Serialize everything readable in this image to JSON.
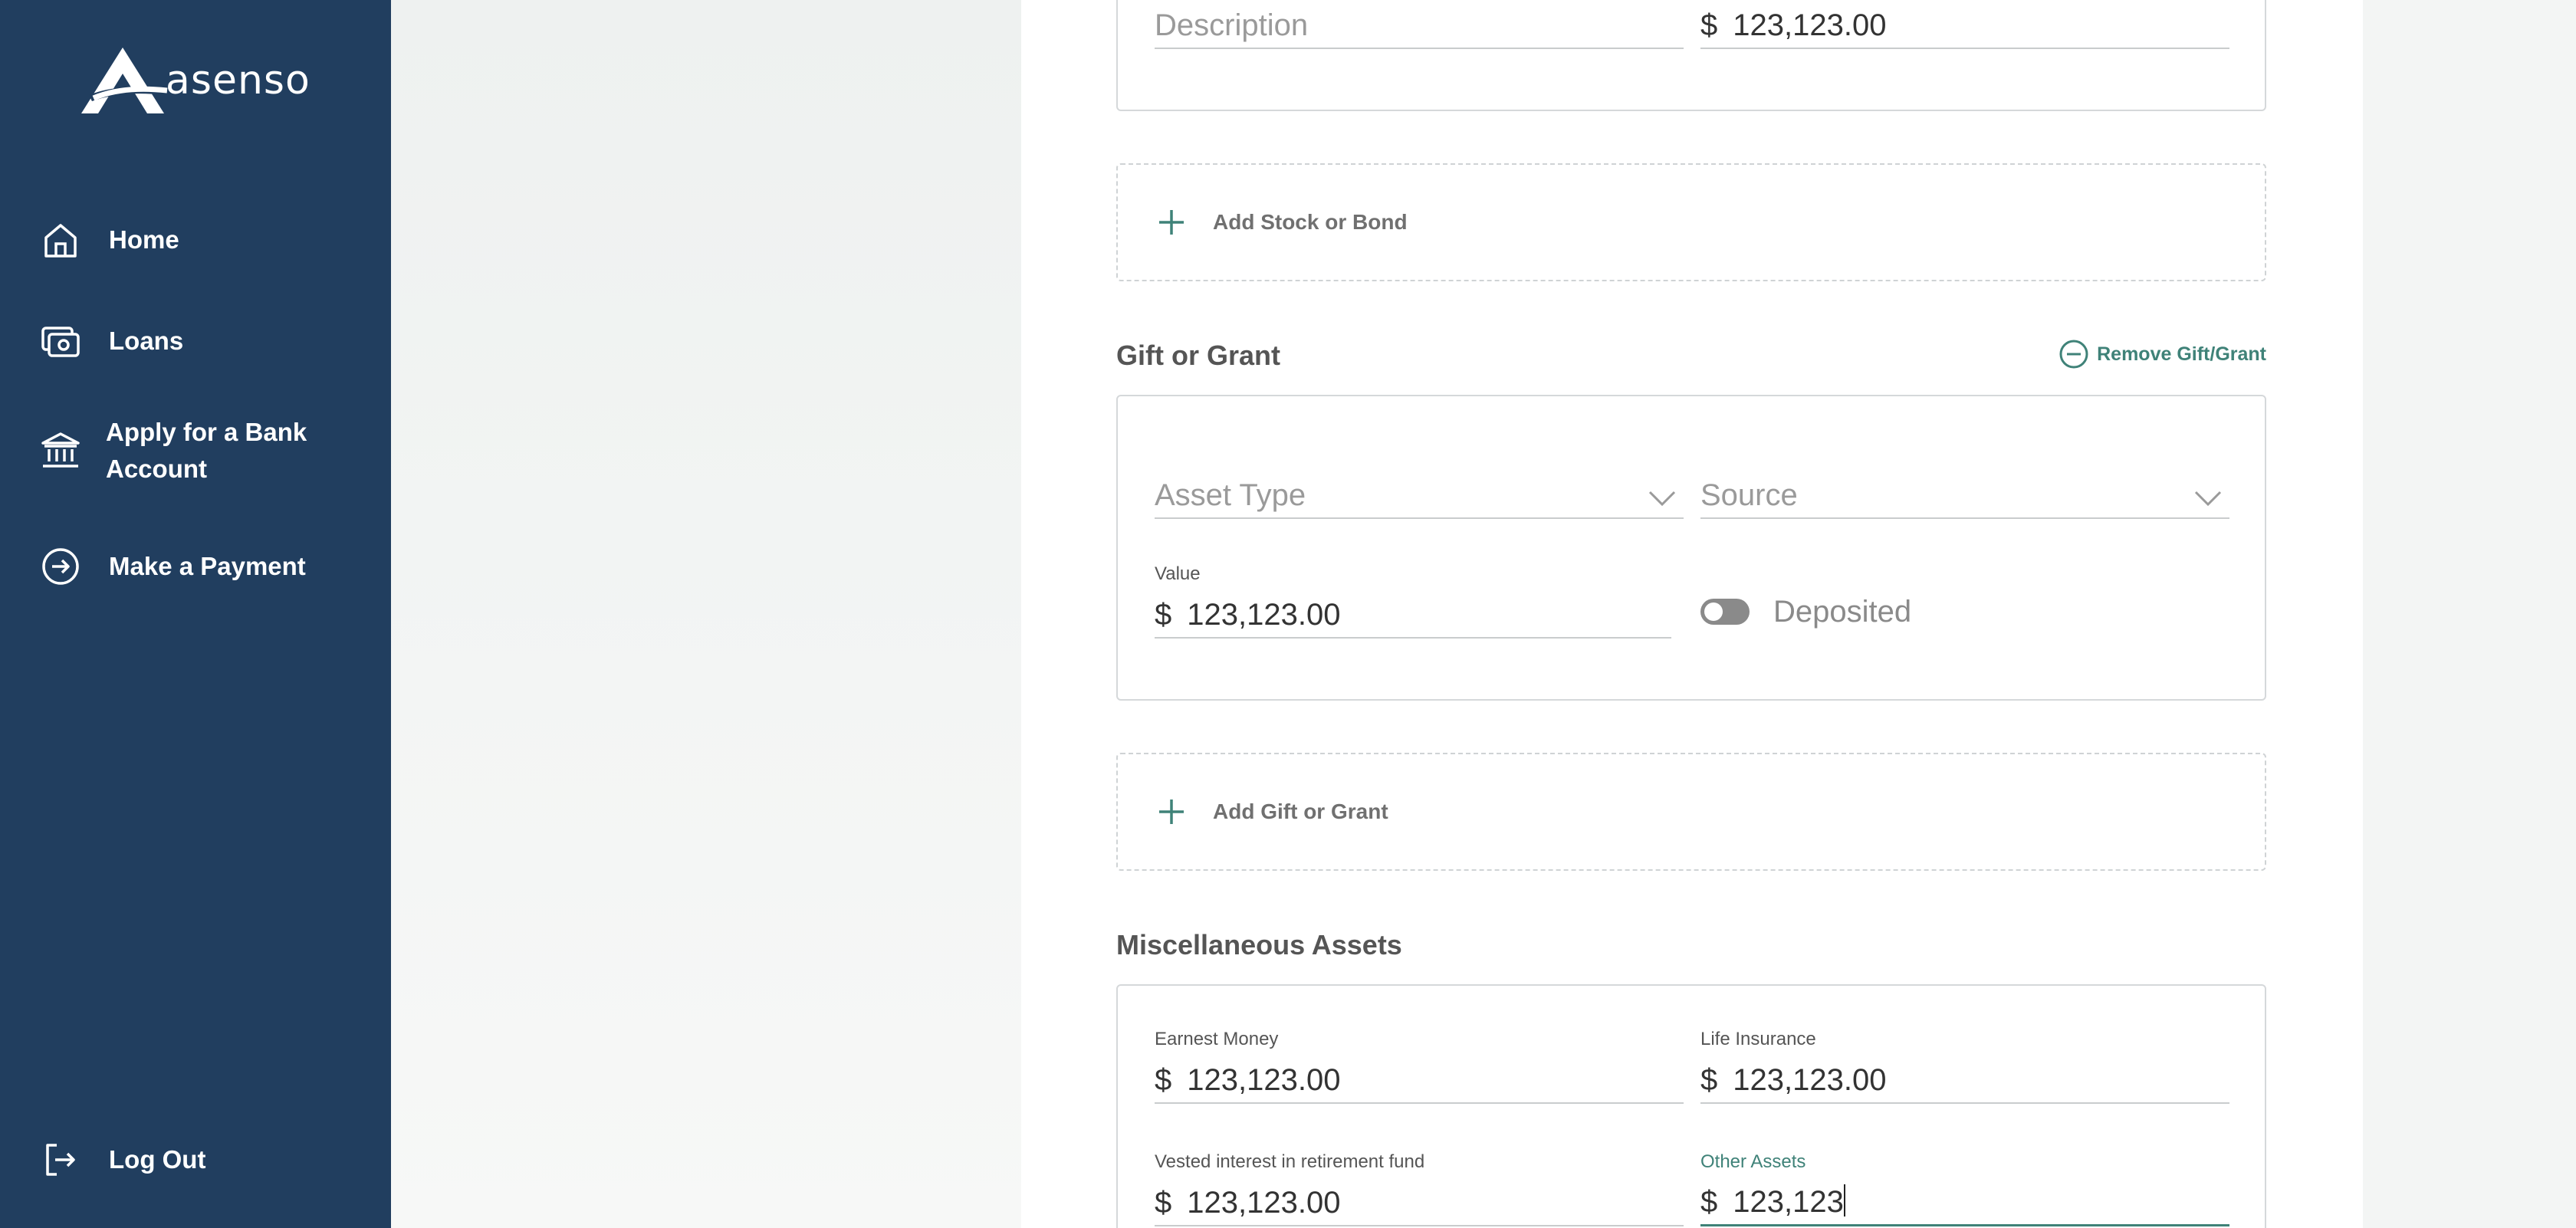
{
  "brand": {
    "logo_text": "asenso",
    "color": "#213e5f",
    "accent": "#3f8278"
  },
  "sidebar": {
    "items": [
      {
        "label": "Home",
        "icon": "home-icon"
      },
      {
        "label": "Loans",
        "icon": "money-icon"
      },
      {
        "label": "Apply for a Bank Account",
        "line1": "Apply for a Bank",
        "line2": "Account",
        "icon": "bank-icon"
      },
      {
        "label": "Make a Payment",
        "icon": "arrow-circle-icon"
      }
    ],
    "logout": {
      "label": "Log Out",
      "icon": "logout-icon"
    }
  },
  "stocks_card": {
    "description_placeholder": "Description",
    "currency": "$",
    "value": "123,123.00"
  },
  "add_stock": {
    "label": "Add Stock or Bond",
    "icon": "plus-icon"
  },
  "gift": {
    "title": "Gift or Grant",
    "remove_label": "Remove Gift/Grant",
    "asset_type_placeholder": "Asset Type",
    "source_placeholder": "Source",
    "value_label": "Value",
    "currency": "$",
    "value": "123,123.00",
    "deposited_label": "Deposited",
    "deposited_on": false
  },
  "add_gift": {
    "label": "Add Gift or Grant",
    "icon": "plus-icon"
  },
  "misc": {
    "title": "Miscellaneous Assets",
    "currency": "$",
    "earnest_label": "Earnest Money",
    "earnest_value": "123,123.00",
    "life_label": "Life Insurance",
    "life_value": "123,123.00",
    "vested_label": "Vested interest in retirement fund",
    "vested_value": "123,123.00",
    "other_label": "Other Assets",
    "other_value": "123,123"
  }
}
